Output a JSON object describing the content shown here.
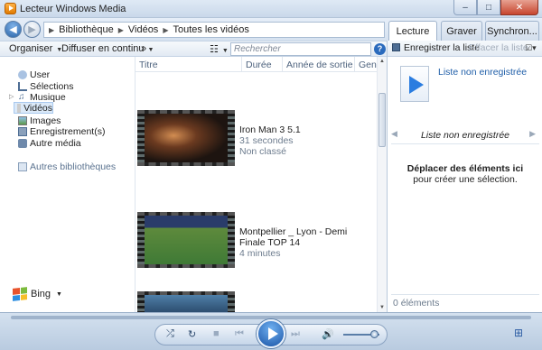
{
  "window": {
    "title": "Lecteur Windows Media",
    "minimize": "–",
    "maximize": "□",
    "close": "✕"
  },
  "address": {
    "back": "◀",
    "forward": "▶",
    "crumbs": [
      "Bibliothèque",
      "Vidéos",
      "Toutes les vidéos"
    ],
    "separator": "▶"
  },
  "tabs": [
    "Lecture",
    "Graver",
    "Synchron..."
  ],
  "toolbar": {
    "organize": "Organiser",
    "stream": "Diffuser en continu",
    "more": "»",
    "search_placeholder": "Rechercher",
    "help": "?"
  },
  "nav": {
    "items": [
      "User",
      "Sélections",
      "Musique",
      "Vidéos",
      "Images",
      "Enregistrement(s)",
      "Autre média"
    ],
    "other_libraries": "Autres bibliothèques",
    "bing": "Bing"
  },
  "columns": [
    "Titre",
    "Durée",
    "Année de sortie",
    "Genre"
  ],
  "videos": [
    {
      "name": "Iron Man 3 5.1",
      "duration": "31 secondes",
      "rating": "Non classé"
    },
    {
      "name": "Montpellier _ Lyon - Demi Finale TOP 14",
      "duration": "4 minutes",
      "rating": ""
    },
    {
      "name": "",
      "duration": "",
      "rating": ""
    }
  ],
  "playlist": {
    "save": "Enregistrer la liste",
    "clear": "Effacer la liste",
    "options": "▾",
    "name": "Liste non enregistrée",
    "nav_label": "Liste non enregistrée",
    "drop_title": "Déplacer des éléments ici",
    "drop_sub": "pour créer une sélection.",
    "count": "0 éléments"
  },
  "controls": {
    "shuffle": "⤮",
    "repeat": "↻",
    "stop": "■",
    "prev": "⏮",
    "next": "⏭",
    "mute": "🔊",
    "volume_fraction": 0.85,
    "switch_view": "⊞"
  },
  "colors": {
    "accent": "#2b7de0",
    "link": "#1f5ea8"
  }
}
